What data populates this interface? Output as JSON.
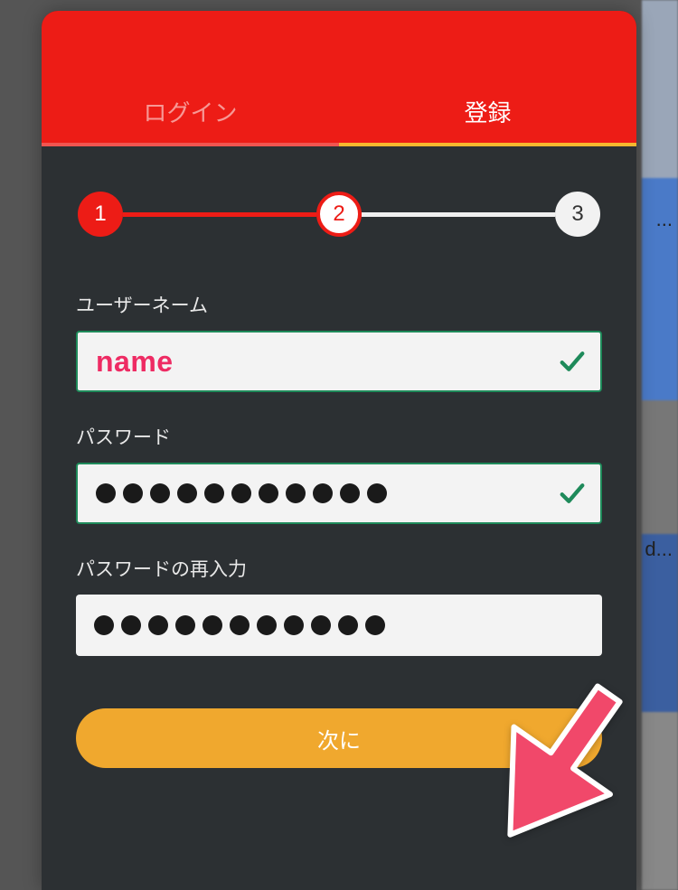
{
  "tabs": {
    "login": "ログイン",
    "register": "登録"
  },
  "stepper": {
    "steps": [
      "1",
      "2",
      "3"
    ]
  },
  "fields": {
    "username": {
      "label": "ユーザーネーム",
      "value": "name",
      "valid": true
    },
    "password": {
      "label": "パスワード",
      "dot_count": 11,
      "valid": true
    },
    "password_confirm": {
      "label": "パスワードの再入力",
      "dot_count": 11,
      "valid": false
    }
  },
  "next_button": "次に",
  "background": {
    "peek_text_1": "...",
    "peek_text_2": "d..."
  },
  "colors": {
    "brand_red": "#ed1c16",
    "accent_yellow": "#f0a82e",
    "valid_green": "#1e8a5a",
    "annotation_pink": "#f1486a",
    "modal_bg": "#2c3033"
  }
}
